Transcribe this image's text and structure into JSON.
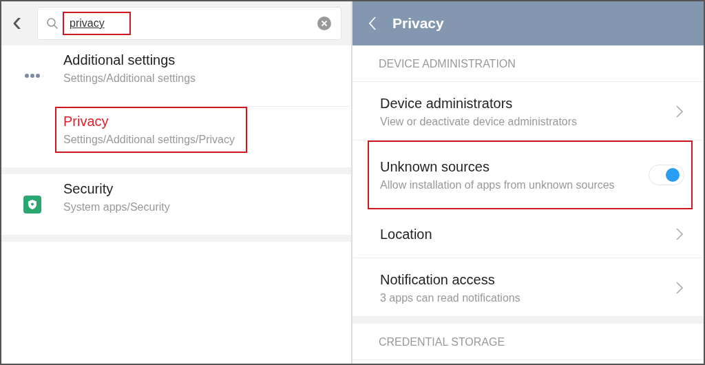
{
  "search_screen": {
    "back": "‹",
    "search": {
      "value": "privacy",
      "highlighted": true
    },
    "groups": [
      {
        "items": [
          {
            "kind": "dots",
            "title": "Additional settings",
            "path": "Settings/Additional settings",
            "highlighted": false
          },
          {
            "kind": "plain",
            "title": "Privacy",
            "path": "Settings/Additional settings/Privacy",
            "highlighted": true
          }
        ]
      },
      {
        "items": [
          {
            "kind": "shield",
            "title": "Security",
            "path": "System apps/Security",
            "highlighted": false
          }
        ]
      }
    ]
  },
  "privacy_screen": {
    "title": "Privacy",
    "sections": [
      {
        "header": "DEVICE ADMINISTRATION",
        "items": [
          {
            "kind": "link",
            "title": "Device administrators",
            "subtitle": "View or deactivate device administrators",
            "highlighted": false
          },
          {
            "kind": "toggle",
            "title": "Unknown sources",
            "subtitle": "Allow installation of apps from unknown sources",
            "on": true,
            "highlighted": true
          },
          {
            "kind": "link",
            "title": "Location",
            "highlighted": false
          },
          {
            "kind": "link",
            "title": "Notification access",
            "subtitle": "3 apps can read notifications",
            "highlighted": false
          }
        ]
      },
      {
        "header": "CREDENTIAL STORAGE"
      }
    ]
  }
}
